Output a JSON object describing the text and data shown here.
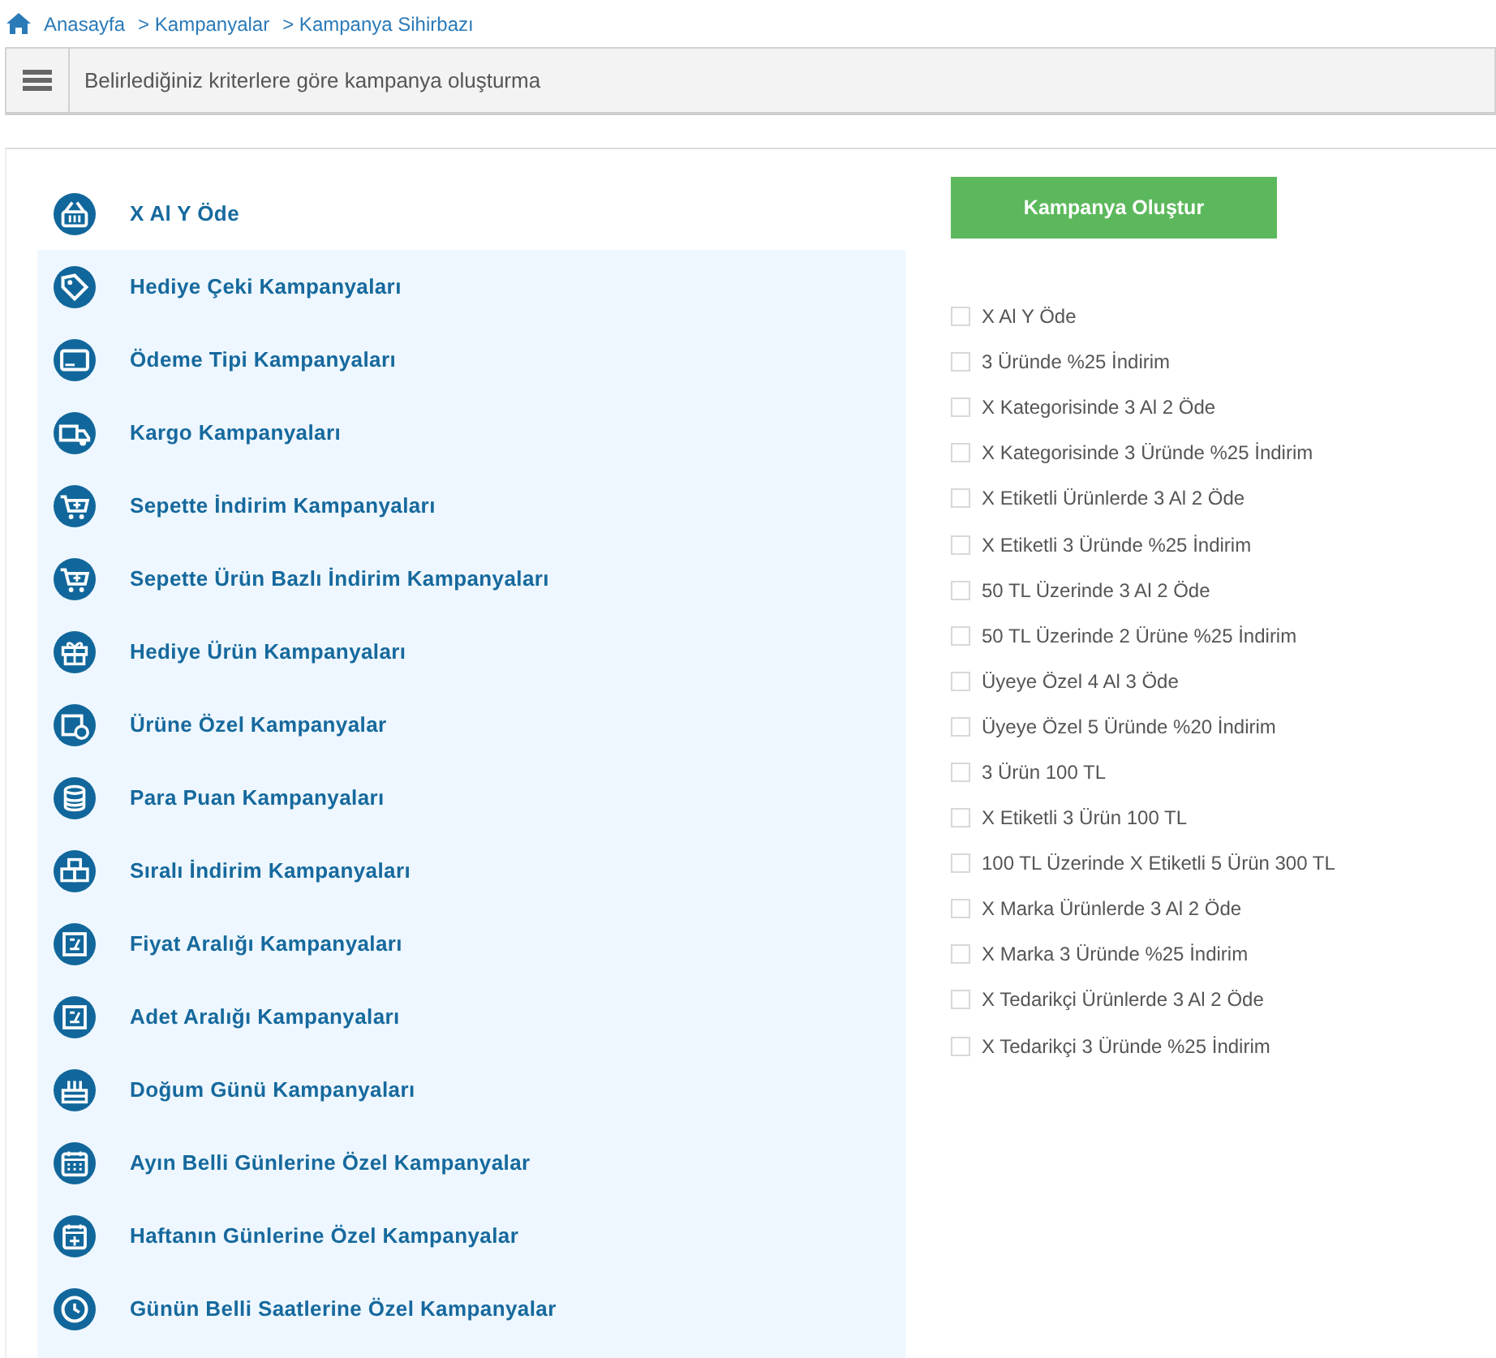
{
  "breadcrumb": [
    {
      "label": "Anasayfa"
    },
    {
      "label": "> Kampanyalar"
    },
    {
      "label": "> Kampanya Sihirbazı"
    }
  ],
  "header": {
    "title": "Belirlediğiniz kriterlere göre kampanya oluşturma"
  },
  "campaign_types": [
    {
      "label": "X Al Y Öde",
      "selected": true
    },
    {
      "label": "Hediye Çeki Kampanyaları",
      "selected": false
    },
    {
      "label": "Ödeme Tipi Kampanyaları",
      "selected": false
    },
    {
      "label": "Kargo Kampanyaları",
      "selected": false
    },
    {
      "label": "Sepette İndirim Kampanyaları",
      "selected": false
    },
    {
      "label": "Sepette Ürün Bazlı İndirim Kampanyaları",
      "selected": false
    },
    {
      "label": "Hediye Ürün Kampanyaları",
      "selected": false
    },
    {
      "label": "Ürüne Özel Kampanyalar",
      "selected": false
    },
    {
      "label": "Para Puan Kampanyaları",
      "selected": false
    },
    {
      "label": "Sıralı İndirim Kampanyaları",
      "selected": false
    },
    {
      "label": "Fiyat Aralığı Kampanyaları",
      "selected": false
    },
    {
      "label": "Adet Aralığı Kampanyaları",
      "selected": false
    },
    {
      "label": "Doğum Günü Kampanyaları",
      "selected": false
    },
    {
      "label": "Ayın Belli Günlerine Özel Kampanyalar",
      "selected": false
    },
    {
      "label": "Haftanın Günlerine Özel Kampanyalar",
      "selected": false
    },
    {
      "label": "Günün Belli Saatlerine Özel Kampanyalar",
      "selected": false
    }
  ],
  "create_button": "Kampanya Oluştur",
  "options": [
    {
      "label": "X Al Y Öde",
      "checked": false
    },
    {
      "label": "3 Üründe %25 İndirim",
      "checked": false
    },
    {
      "label": "X Kategorisinde 3 Al 2 Öde",
      "checked": false
    },
    {
      "label": "X Kategorisinde 3 Üründe %25 İndirim",
      "checked": false
    },
    {
      "label": "X Etiketli Ürünlerde 3 Al 2 Öde",
      "checked": false
    },
    {
      "label": "X Etiketli 3 Üründe %25 İndirim",
      "checked": false
    },
    {
      "label": "50 TL Üzerinde 3 Al 2 Öde",
      "checked": false
    },
    {
      "label": "50 TL Üzerinde 2 Ürüne %25 İndirim",
      "checked": false
    },
    {
      "label": "Üyeye Özel 4 Al 3 Öde",
      "checked": false
    },
    {
      "label": "Üyeye Özel 5 Üründe %20 İndirim",
      "checked": false
    },
    {
      "label": "3 Ürün 100 TL",
      "checked": false
    },
    {
      "label": "X Etiketli 3 Ürün 100 TL",
      "checked": false
    },
    {
      "label": "100 TL Üzerinde X Etiketli 5 Ürün 300 TL",
      "checked": false
    },
    {
      "label": "X Marka Ürünlerde 3 Al 2 Öde",
      "checked": false
    },
    {
      "label": "X Marka 3 Üründe %25 İndirim",
      "checked": false
    },
    {
      "label": "X Tedarikçi Ürünlerde 3 Al 2 Öde",
      "checked": false
    },
    {
      "label": "X Tedarikçi 3 Üründe %25 İndirim",
      "checked": false
    }
  ]
}
